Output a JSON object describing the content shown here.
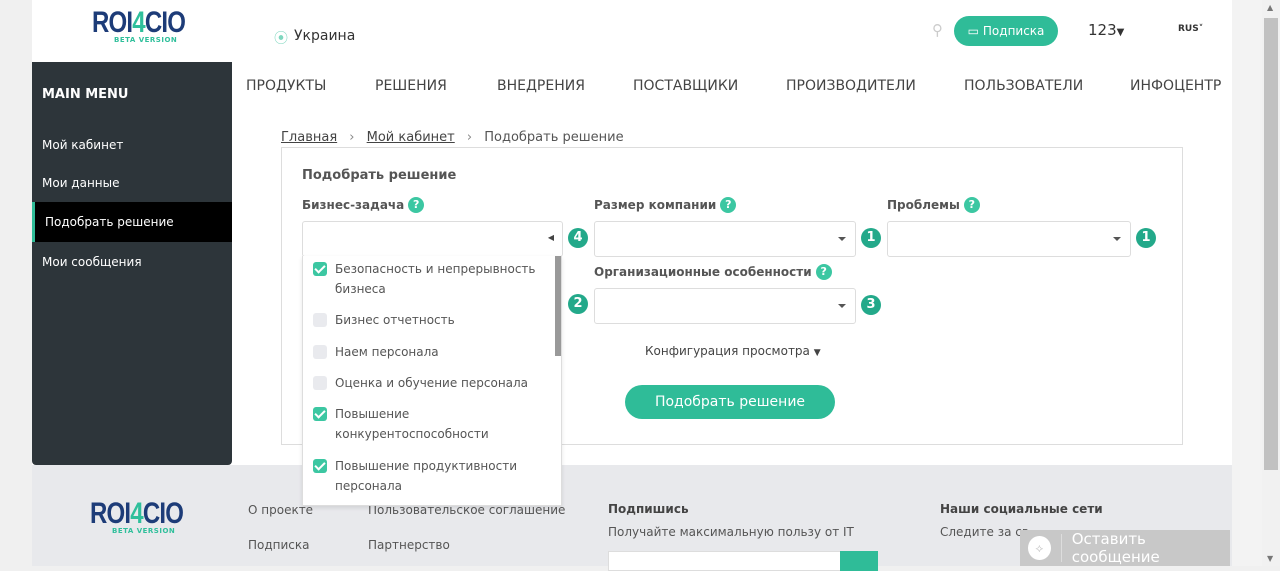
{
  "header": {
    "logo_text": "ROI4CIO",
    "logo_sub": "BETA VERSION",
    "location": "Украина",
    "subscribe": "Подписка",
    "user": "123",
    "lang": "RUS"
  },
  "nav": [
    "ПРОДУКТЫ",
    "РЕШЕНИЯ",
    "ВНЕДРЕНИЯ",
    "ПОСТАВЩИКИ",
    "ПРОИЗВОДИТЕЛИ",
    "ПОЛЬЗОВАТЕЛИ",
    "ИНФОЦЕНТР"
  ],
  "sidebar": {
    "title": "MAIN MENU",
    "items": [
      "Мой кабинет",
      "Мои данные",
      "Подобрать решение",
      "Мои сообщения"
    ]
  },
  "breadcrumb": [
    "Главная",
    "Мой кабинет",
    "Подобрать решение"
  ],
  "form": {
    "title": "Подобрать решение",
    "business_task": {
      "label": "Бизнес-задача",
      "count": "4"
    },
    "company_size": {
      "label": "Размер компании",
      "count": "1"
    },
    "problems": {
      "label": "Проблемы",
      "count": "1"
    },
    "org": {
      "label": "Организационные особенности",
      "count": "3"
    },
    "view_config": "Конфигурация просмотра",
    "submit": "Подобрать решение",
    "left_count": "2"
  },
  "dropdown": [
    {
      "label": "Безопасность и непрерывность бизнеса",
      "checked": true
    },
    {
      "label": "Бизнес отчетность",
      "checked": false
    },
    {
      "label": "Наем персонала",
      "checked": false
    },
    {
      "label": "Оценка и обучение персонала",
      "checked": false
    },
    {
      "label": "Повышение конкурентоспособности",
      "checked": true
    },
    {
      "label": "Повышение продуктивности персонала",
      "checked": true
    }
  ],
  "footer": {
    "links": [
      "О проекте",
      "Пользовательское соглашение",
      "Подписка",
      "Партнерство"
    ],
    "subscribe_title": "Подпишись",
    "subscribe_text": "Получайте максимальную пользу от IT",
    "social_title": "Наши социальные сети",
    "social_text": "Следите за св"
  },
  "chat": "Оставить сообщение"
}
